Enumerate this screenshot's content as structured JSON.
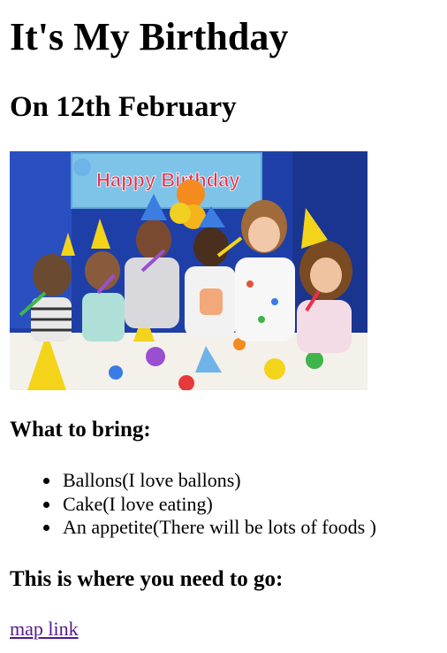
{
  "title": "It's My Birthday",
  "date": "On 12th February",
  "photo": {
    "banner_text": "Happy Birthday"
  },
  "bring": {
    "heading": "What to bring:",
    "items": [
      "Ballons(I love ballons)",
      "Cake(I love eating)",
      "An appetite(There will be lots of foods )"
    ]
  },
  "directions": {
    "heading": "This is where you need to go:",
    "link_text": "map link"
  },
  "colors": {
    "link_visited": "#551a8b",
    "photo_backdrop": "#1d3a9a"
  }
}
